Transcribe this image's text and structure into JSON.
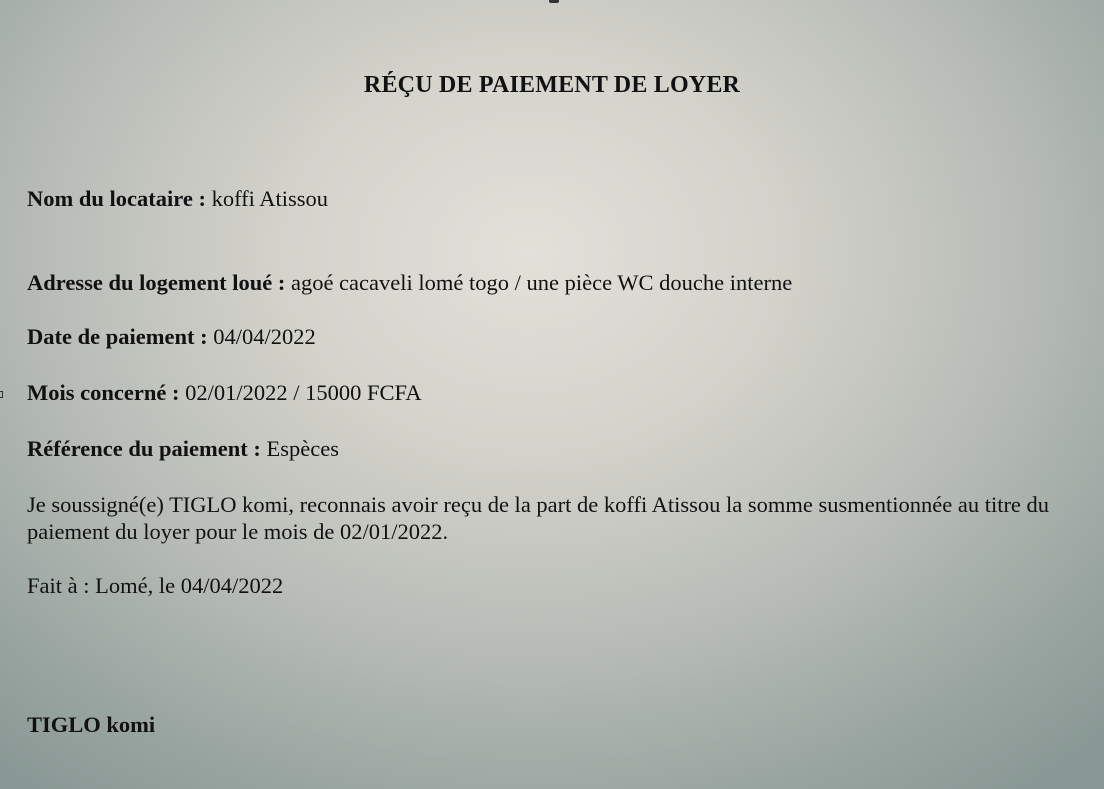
{
  "receipt": {
    "title": "RÉÇU DE PAIEMENT DE LOYER",
    "fields": [
      {
        "label": "Nom du locataire :",
        "value": "koffi Atissou"
      },
      {
        "label": "Adresse du logement loué :",
        "value": "agoé cacaveli lomé togo / une pièce WC douche interne"
      },
      {
        "label": "Date de paiement :",
        "value": "04/04/2022"
      },
      {
        "label": "Mois concerné :",
        "value": "02/01/2022 / 15000 FCFA"
      },
      {
        "label": "Référence du paiement :",
        "value": "Espèces"
      }
    ],
    "statement": "Je soussigné(e) TIGLO komi, reconnais avoir reçu de la part de koffi Atissou la somme susmentionnée au titre du paiement du loyer pour le mois de 02/01/2022.",
    "made_at": "Fait à : Lomé, le 04/04/2022",
    "signature": "TIGLO komi"
  }
}
